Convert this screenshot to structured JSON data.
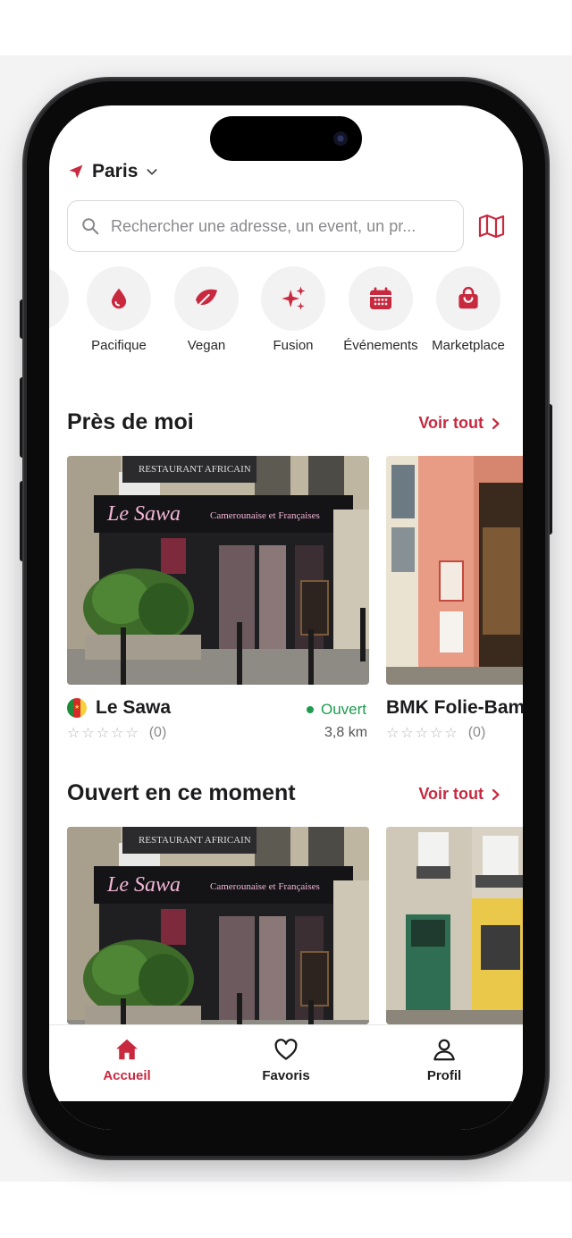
{
  "colors": {
    "accent": "#c8293f",
    "open_green": "#1e9b4f",
    "icon_bg": "#f2f2f3"
  },
  "location": {
    "icon": "navigation-arrow-icon",
    "city": "Paris"
  },
  "search": {
    "placeholder": "Rechercher une adresse, un event, un pr..."
  },
  "categories": [
    {
      "label": "Pacifique",
      "icon": "droplet-icon"
    },
    {
      "label": "Vegan",
      "icon": "leaf-icon"
    },
    {
      "label": "Fusion",
      "icon": "sparkles-icon"
    },
    {
      "label": "Événements",
      "icon": "calendar-icon"
    },
    {
      "label": "Marketplace",
      "icon": "shopping-bag-icon"
    }
  ],
  "sections": [
    {
      "title": "Près de moi",
      "see_all": "Voir tout",
      "cards": [
        {
          "name": "Le Sawa",
          "rating_count": "(0)",
          "rating": 0,
          "status": "Ouvert",
          "distance": "3,8 km",
          "sign_text": "Le Sawa",
          "sign_sub": "Camerounaise et Françaises",
          "sign_top": "RESTAURANT AFRICAIN"
        },
        {
          "name": "BMK Folie-Bam",
          "rating_count": "(0)",
          "rating": 0
        }
      ]
    },
    {
      "title": "Ouvert en ce moment",
      "see_all": "Voir tout",
      "cards": [
        {
          "sign_text": "Le Sawa",
          "sign_sub": "Camerounaise et Françaises",
          "sign_top": "RESTAURANT AFRICAIN"
        },
        {}
      ]
    }
  ],
  "tabbar": [
    {
      "label": "Accueil",
      "icon": "home-icon",
      "active": true
    },
    {
      "label": "Favoris",
      "icon": "heart-icon",
      "active": false
    },
    {
      "label": "Profil",
      "icon": "user-icon",
      "active": false
    }
  ]
}
